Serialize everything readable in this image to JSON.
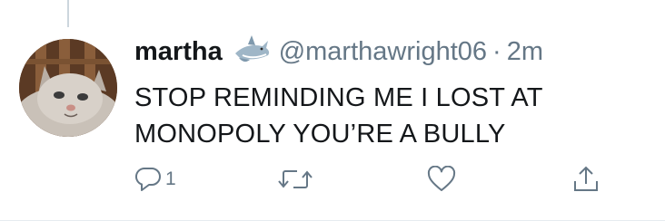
{
  "tweet": {
    "display_name": "martha",
    "emoji": "shark",
    "handle": "@marthawright06",
    "separator": "·",
    "timestamp": "2m",
    "text": "STOP REMINDING ME I LOST AT MONOPOLY YOU’RE A BULLY"
  },
  "actions": {
    "reply_count": "1",
    "retweet_count": "",
    "like_count": ""
  },
  "colors": {
    "text_primary": "#14171a",
    "text_secondary": "#657786",
    "thread_line": "#ccd6dd"
  },
  "icons": [
    "reply-icon",
    "retweet-icon",
    "like-icon",
    "share-icon",
    "shark-emoji"
  ]
}
